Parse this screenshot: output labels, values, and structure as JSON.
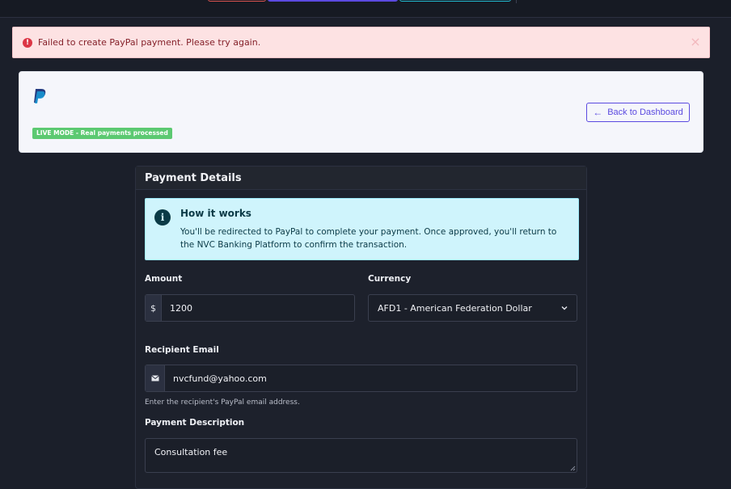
{
  "alert": {
    "message": "Failed to create PayPal payment. Please try again.",
    "icon": "exclamation-circle-icon",
    "close_glyph": "×"
  },
  "header": {
    "live_badge": "LIVE MODE - Real payments processed",
    "back_label": "Back to Dashboard",
    "logo": "paypal-logo",
    "back_arrow": "←"
  },
  "panel": {
    "title": "Payment Details",
    "info": {
      "title": "How it works",
      "text": "You'll be redirected to PayPal to complete your payment. Once approved, you'll return to the NVC Banking Platform to confirm the transaction.",
      "icon_glyph": "i"
    },
    "amount": {
      "label": "Amount",
      "prefix": "$",
      "value": "1200"
    },
    "currency": {
      "label": "Currency",
      "value": "AFD1 - American Federation Dollar"
    },
    "email": {
      "label": "Recipient Email",
      "value": "nvcfund@yahoo.com",
      "help": "Enter the recipient's PayPal email address."
    },
    "description": {
      "label": "Payment Description",
      "value": "Consultation fee"
    }
  },
  "colors": {
    "accent": "#5b4ae0",
    "live_badge": "#5cc971",
    "alert_bg": "#fde2e3",
    "info_bg": "#cff4fc"
  }
}
